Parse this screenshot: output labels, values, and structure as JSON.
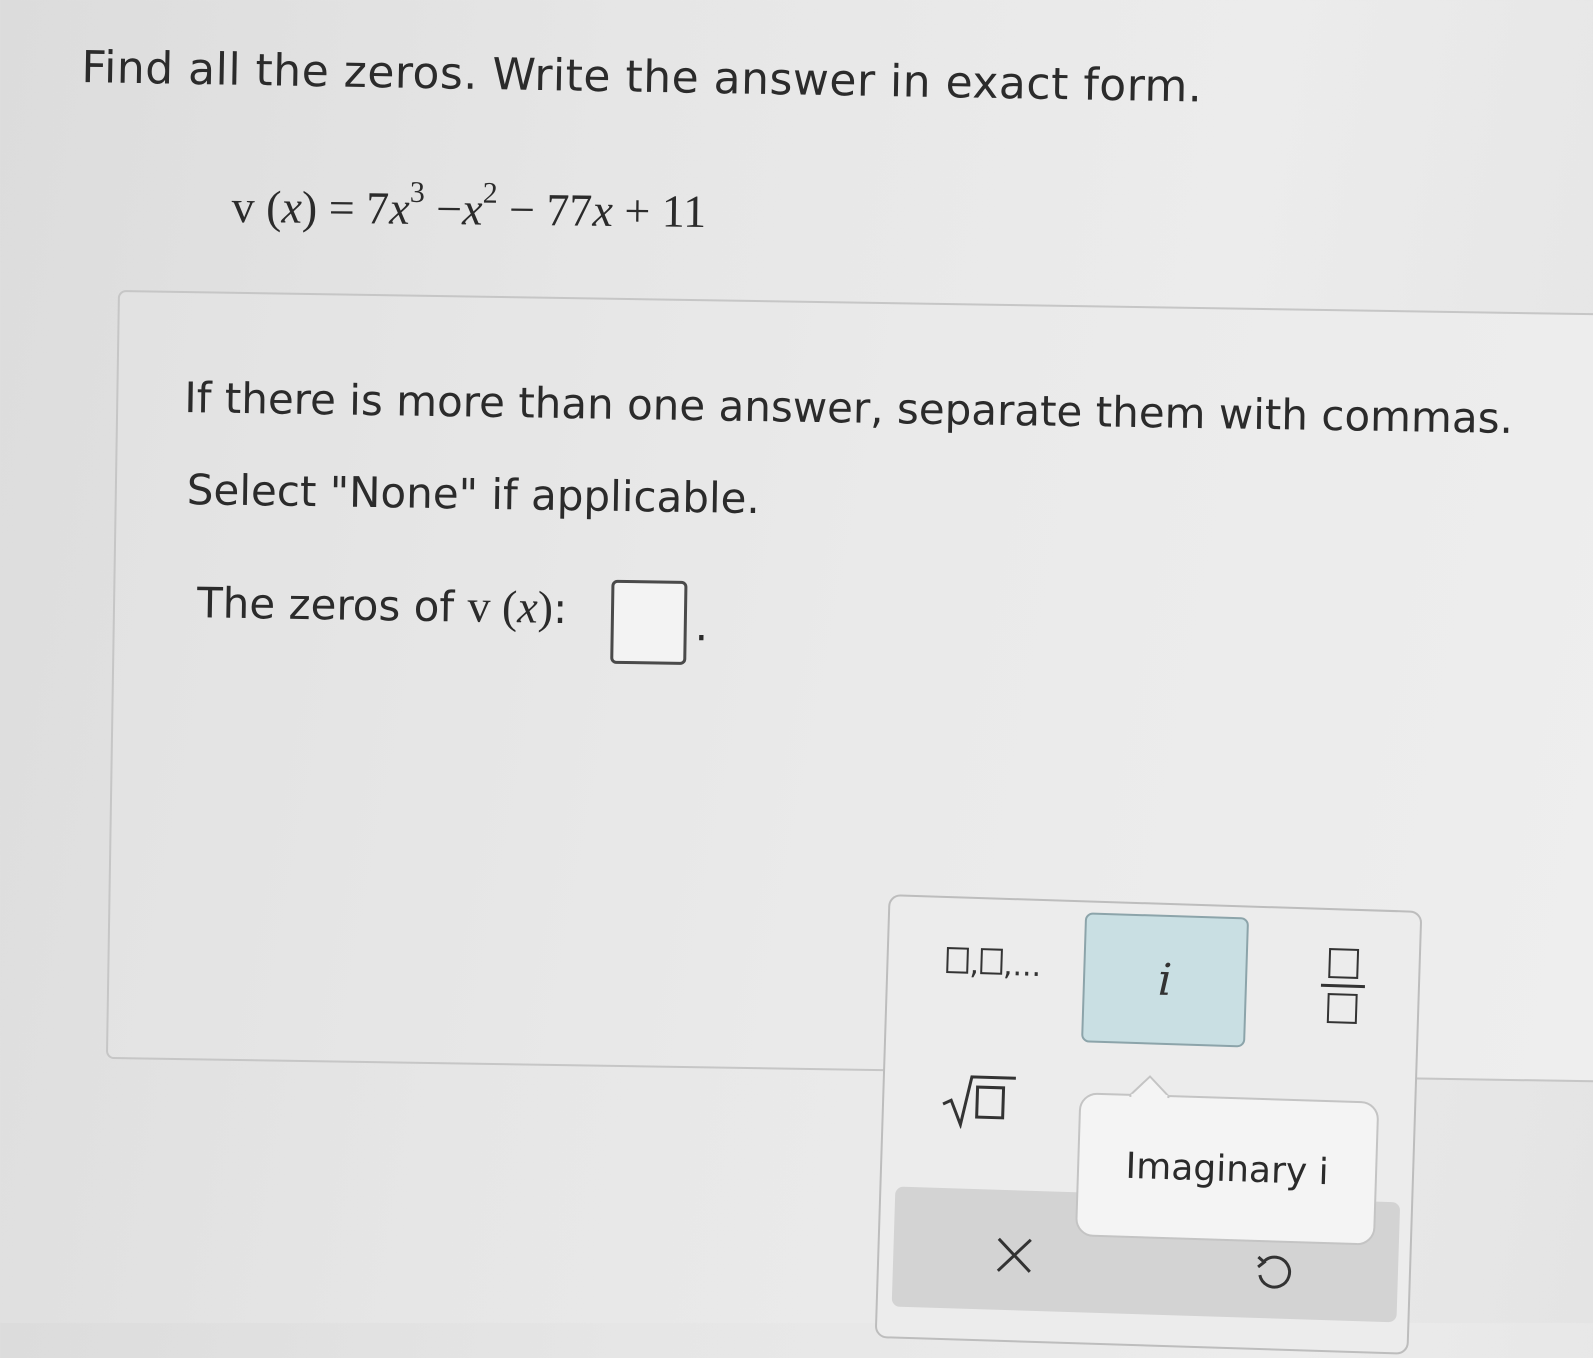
{
  "question": {
    "instruction": "Find all the zeros. Write the answer in exact form.",
    "equation": {
      "func": "v",
      "var": "x",
      "equals": "=",
      "coef1": "7",
      "exp1": "3",
      "minus1": " −",
      "exp2": "2",
      "minus2": " − 77",
      "plus": " + 11"
    }
  },
  "answer": {
    "separate_instruction": "If there is more than one answer, separate them with commas.",
    "none_instruction": "Select \"None\" if applicable.",
    "zeros_label_prefix": "The zeros of ",
    "zeros_label_suffix": ":",
    "input_value": "",
    "period": "."
  },
  "keypad": {
    "list_key_suffix": ",...",
    "imaginary_key": "i",
    "tooltip": "Imaginary i",
    "icons": [
      "list-icon",
      "imaginary-i-icon",
      "fraction-icon",
      "sqrt-icon",
      "clear-x-icon",
      "undo-icon"
    ]
  }
}
